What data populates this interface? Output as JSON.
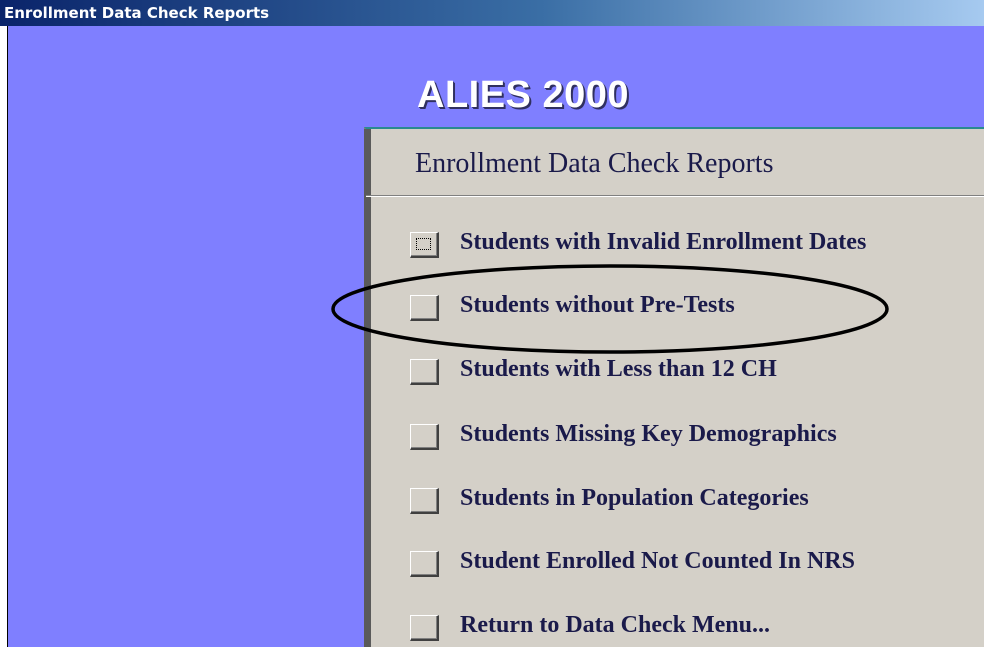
{
  "window": {
    "title": "Enrollment Data Check Reports"
  },
  "app": {
    "title": "ALIES 2000"
  },
  "panel": {
    "heading": "Enrollment Data Check Reports",
    "items": [
      {
        "label": "Students with Invalid Enrollment Dates",
        "focused": true
      },
      {
        "label": "Students without Pre-Tests",
        "highlighted": true
      },
      {
        "label": "Students with Less than 12 CH"
      },
      {
        "label": "Students Missing Key Demographics"
      },
      {
        "label": "Students in Population Categories"
      },
      {
        "label": "Student Enrolled Not Counted In NRS"
      },
      {
        "label": "Return to Data Check Menu..."
      }
    ]
  },
  "colors": {
    "background": "#7f7fff",
    "panel": "#d4d0c8",
    "text": "#1a1a4a",
    "titlebar_start": "#0a246a"
  }
}
